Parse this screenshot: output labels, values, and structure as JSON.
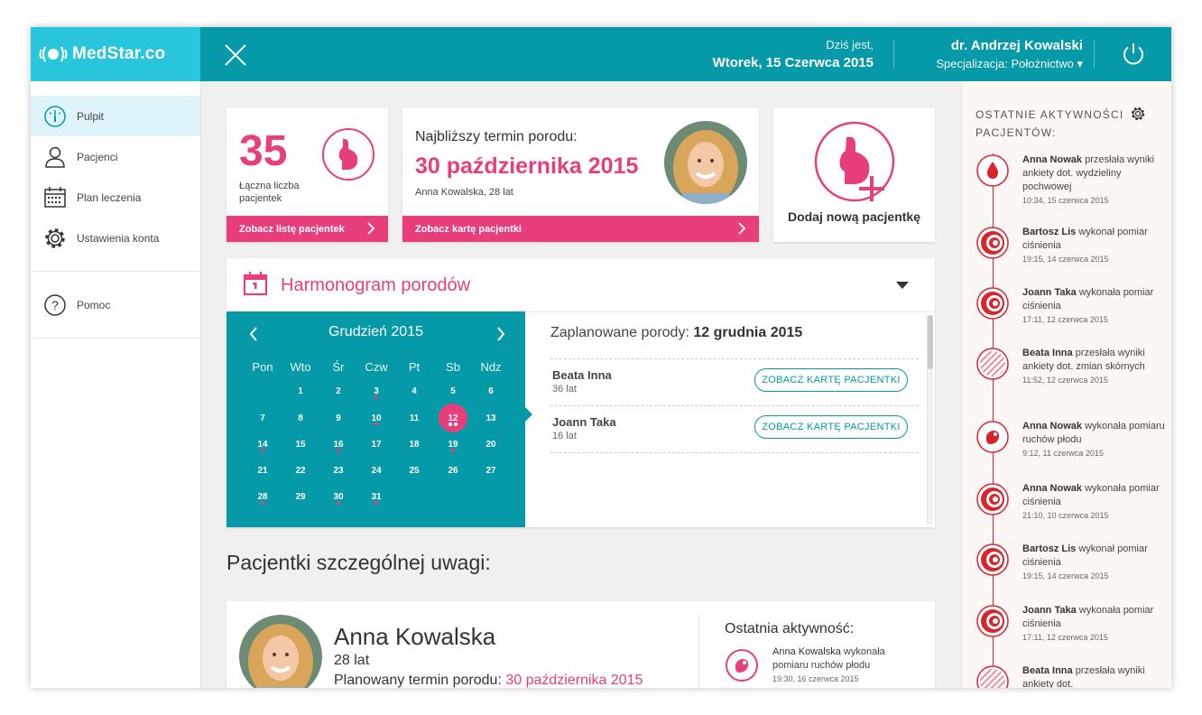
{
  "app": {
    "logo_text": "MedStar.co"
  },
  "header": {
    "date_label": "Dziś jest,",
    "date_value": "Wtorek, 15 Czerwca 2015",
    "doctor_name": "dr. Andrzej Kowalski",
    "doctor_spec": "Specjalizacja: Położnictwo ▾"
  },
  "sidebar": {
    "items": [
      {
        "label": "Pulpit",
        "icon": "gauge-icon"
      },
      {
        "label": "Pacjenci",
        "icon": "user-icon"
      },
      {
        "label": "Plan leczenia",
        "icon": "calendar-icon"
      },
      {
        "label": "Ustawienia konta",
        "icon": "gear-icon"
      },
      {
        "label": "Pomoc",
        "icon": "help-icon"
      }
    ]
  },
  "stats": {
    "count": "35",
    "count_label": "Łączna liczba pacjentek",
    "list_link": "Zobacz listę pacjentek"
  },
  "next_term": {
    "label": "Najbliższy termin porodu:",
    "date": "30 października 2015",
    "patient": "Anna Kowalska, 28 lat",
    "link": "Zobacz kartę pacjentki"
  },
  "add_patient": {
    "label": "Dodaj nową pacjentkę"
  },
  "schedule": {
    "title": "Harmonogram porodów",
    "calendar": {
      "month": "Grudzień 2015",
      "weekdays": [
        "Pon",
        "Wto",
        "Śr",
        "Czw",
        "Pt",
        "Sb",
        "Ndz"
      ],
      "first_weekday_index": 1,
      "days_in_month": 31,
      "selected_day": 12,
      "marked": {
        "3": 1,
        "10": 1,
        "12": 2,
        "14": 1,
        "16": 1,
        "19": 1,
        "28": 1,
        "30": 1,
        "31": 1
      }
    },
    "planned_label": "Zaplanowane porody:",
    "planned_date": "12 grudnia 2015",
    "births": [
      {
        "name": "Beata Inna",
        "age": "36 lat",
        "button": "ZOBACZ KARTĘ PACJENTKI"
      },
      {
        "name": "Joann Taka",
        "age": "16 lat",
        "button": "ZOBACZ KARTĘ PACJENTKI"
      }
    ]
  },
  "special": {
    "title": "Pacjentki szczególnej uwagi:",
    "patient": {
      "name": "Anna Kowalska",
      "age": "28 lat",
      "term_label": "Planowany termin porodu:",
      "term_date": "30 października 2015"
    },
    "last_activity": {
      "title": "Ostatnia aktywność:",
      "who": "Anna Kowalska",
      "what": "wykonała pomiaru ruchów płodu",
      "time": "19:30, 16 czerwca 2015"
    }
  },
  "activity": {
    "title": "OSTATNIE AKTYWNOŚCI PACJENTÓW:",
    "items": [
      {
        "who": "Anna Nowak",
        "what": "przesłała wyniki ankiety dot. wydzieliny pochwowej",
        "time": "10:34, 15 czerwca 2015",
        "icon": "drop-icon"
      },
      {
        "who": "Bartosz Lis",
        "what": "wykonał pomiar ciśnienia",
        "time": "19:15, 14 czerwca 2015",
        "icon": "pressure-icon"
      },
      {
        "who": "Joann Taka",
        "what": "wykonała pomiar ciśnienia",
        "time": "17:11, 12 czerwca 2015",
        "icon": "pressure-icon"
      },
      {
        "who": "Beata Inna",
        "what": "przesłała wyniki ankiety dot. zmian skórnych",
        "time": "11:52, 12 czerwca 2015",
        "icon": "skin-icon"
      },
      {
        "who": "Anna Nowak",
        "what": "wykonała pomiaru ruchów płodu",
        "time": "9:12, 11 czerwca 2015",
        "icon": "fetus-icon"
      },
      {
        "who": "Anna Nowak",
        "what": "wykonała pomiar ciśnienia",
        "time": "21:10, 10 czerwca 2015",
        "icon": "pressure-icon"
      },
      {
        "who": "Bartosz Lis",
        "what": "wykonał pomiar ciśnienia",
        "time": "19:15, 14 czerwca 2015",
        "icon": "pressure-icon"
      },
      {
        "who": "Joann Taka",
        "what": "wykonała pomiar ciśnienia",
        "time": "17:11, 12 czerwca 2015",
        "icon": "pressure-icon"
      },
      {
        "who": "Beata Inna",
        "what": "przesłała wyniki ankiety dot.",
        "time": "",
        "icon": "skin-icon"
      }
    ]
  },
  "colors": {
    "teal": "#0699a7",
    "cyan": "#29c5dc",
    "pink": "#e83e7c",
    "red": "#d8242f"
  }
}
